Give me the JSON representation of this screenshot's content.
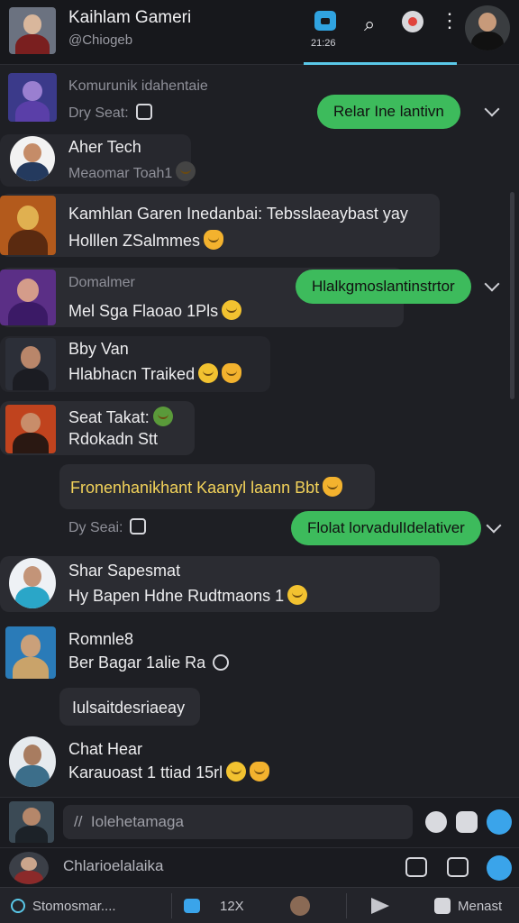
{
  "header": {
    "title": "Kaihlam Gameri",
    "handle": "@Chiogeb",
    "tab_label": "21:26",
    "icons": [
      "link-icon",
      "record-icon",
      "more-icon"
    ]
  },
  "messages": [
    {
      "meta": "Komurunik idahentaie",
      "sub": "Dry Seat:",
      "reply": "Relar Ine lantivn"
    },
    {
      "name": "Aher Tech",
      "sub": "Meaomar Toah1"
    },
    {
      "line1": "Kamhlan Garen Inedanbai: Tebsslaeaybast yay",
      "line2": "Holllen ZSalmmes"
    },
    {
      "meta": "Domalmer",
      "line1": "Mel Sga Flaoao  1Pls",
      "reply": "Hlalkgmoslantinstrtor"
    },
    {
      "name": "Bby Van",
      "line1": "Hlabhacn Traiked"
    },
    {
      "name": "Seat Takat:",
      "line1": "Rdokadn Stt"
    },
    {
      "line1": "Fronenhanikhant Kaanyl laann Bbt"
    },
    {
      "sub": "Dy Seai:",
      "reply": "Flolat lorvadulIdelativer"
    },
    {
      "name": "Shar Sapesmat",
      "line1": "Hy Bapen Hdne Rudtmaons 1"
    },
    {
      "name": "Romnle8",
      "line1": "Ber Bagar 1alie Ra"
    },
    {
      "line1": "Iulsaitdesriaeay"
    },
    {
      "name": "Chat Hear",
      "line1": "Karauoast 1 ttiad  15rl"
    }
  ],
  "composer": {
    "placeholder": "//  Iolehetamaga",
    "status_text": "Chlarioelalaika"
  },
  "bottom_bar": {
    "item1": "Stomosmar....",
    "item2": "12X",
    "item3": "Menast"
  },
  "colors": {
    "accent_green": "#3dbb5c",
    "accent_blue": "#30a3e0",
    "background": "#1e1f24"
  }
}
